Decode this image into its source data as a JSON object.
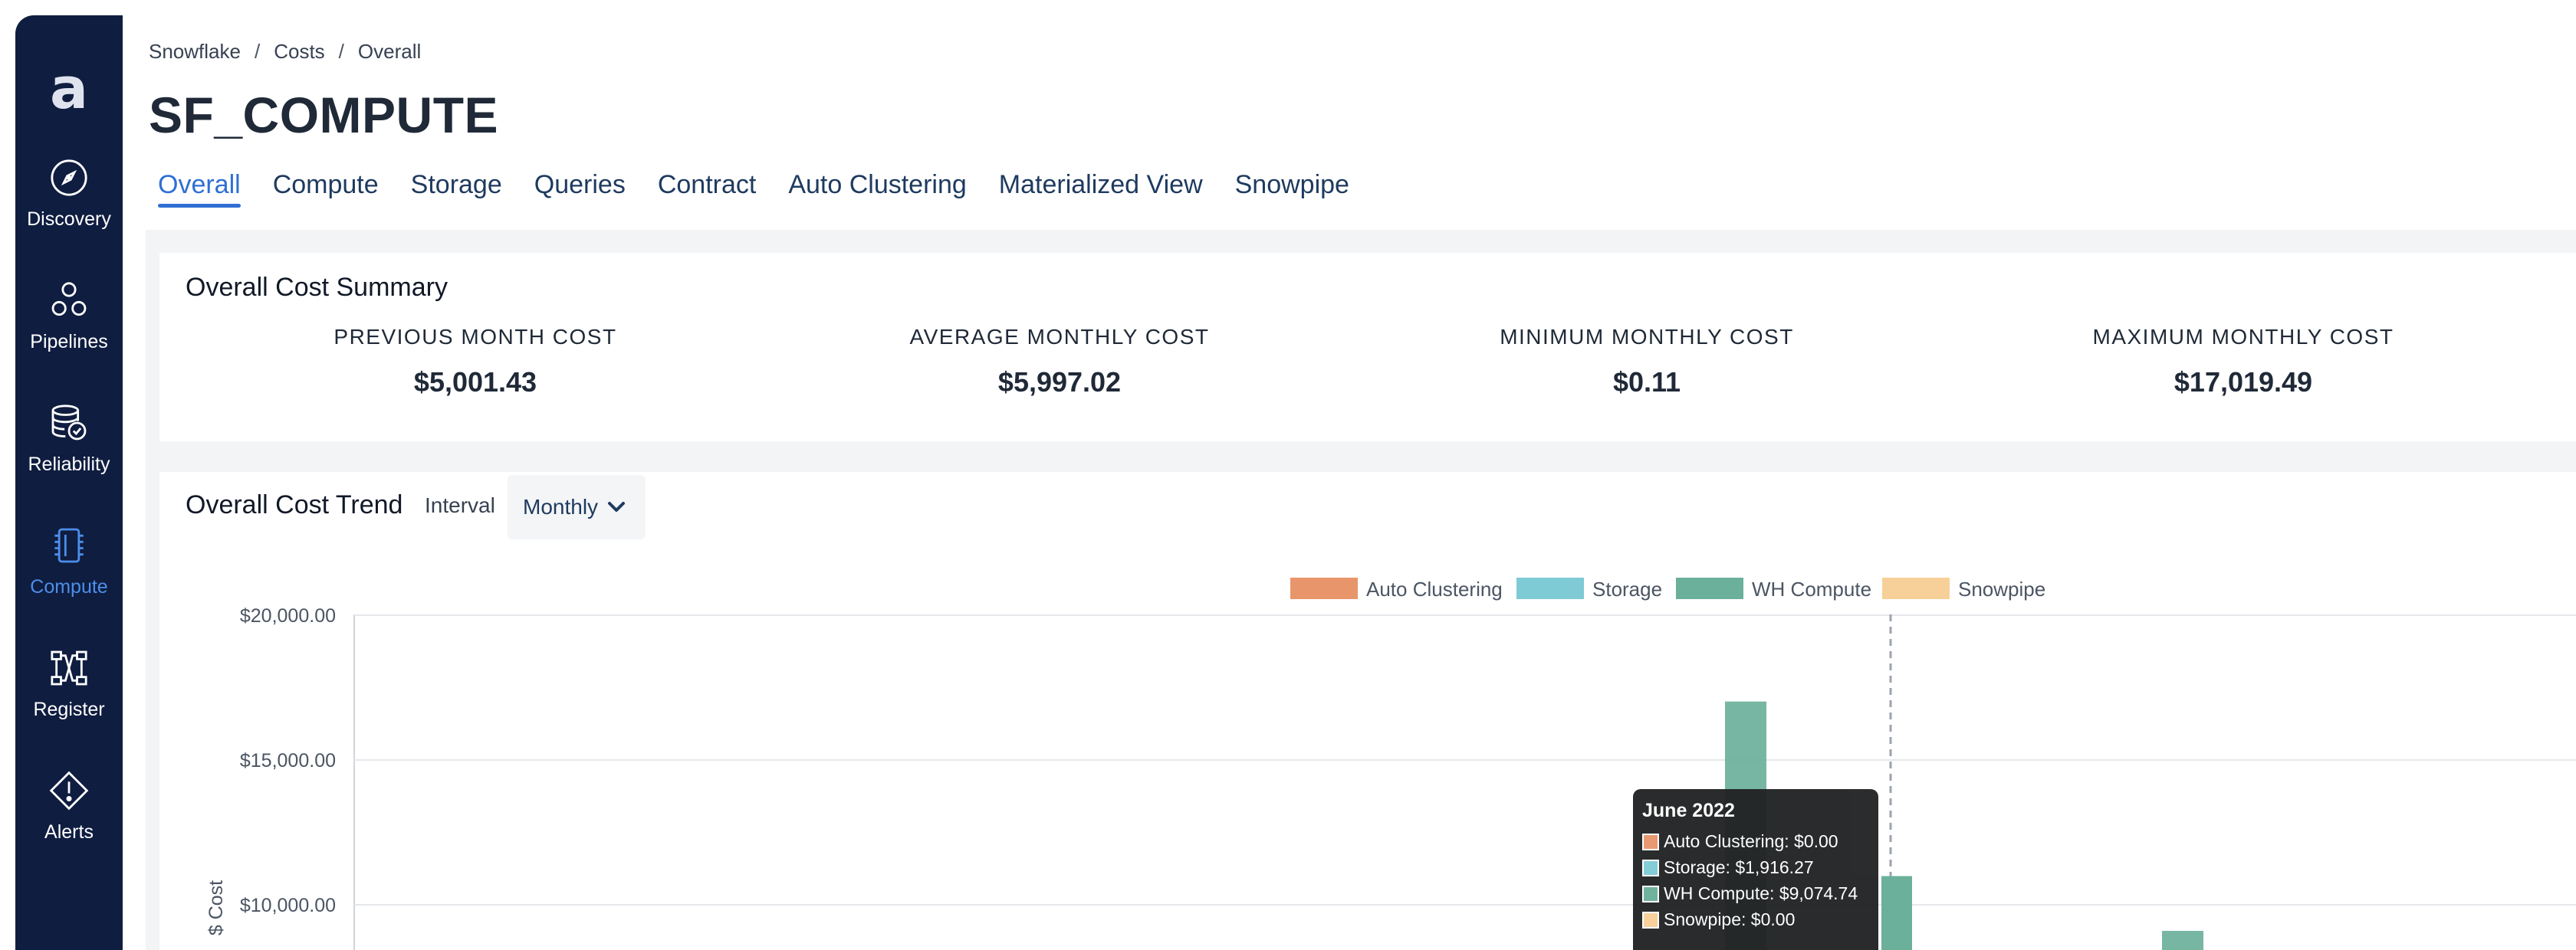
{
  "sidebar": {
    "logo": "a",
    "items": [
      {
        "label": "Discovery",
        "icon": "compass-icon",
        "active": false
      },
      {
        "label": "Pipelines",
        "icon": "pipelines-icon",
        "active": false
      },
      {
        "label": "Reliability",
        "icon": "database-check-icon",
        "active": false
      },
      {
        "label": "Compute",
        "icon": "chip-icon",
        "active": true
      },
      {
        "label": "Register",
        "icon": "register-icon",
        "active": false
      },
      {
        "label": "Alerts",
        "icon": "alert-diamond-icon",
        "active": false
      }
    ]
  },
  "breadcrumb": [
    "Snowflake",
    "Costs",
    "Overall"
  ],
  "breadcrumb_sep": "/",
  "title": "SF_COMPUTE",
  "tabs": [
    "Overall",
    "Compute",
    "Storage",
    "Queries",
    "Contract",
    "Auto Clustering",
    "Materialized View",
    "Snowpipe"
  ],
  "active_tab": "Overall",
  "summary": {
    "title": "Overall Cost Summary",
    "metrics": [
      {
        "label": "PREVIOUS MONTH COST",
        "value": "$5,001.43"
      },
      {
        "label": "AVERAGE MONTHLY COST",
        "value": "$5,997.02"
      },
      {
        "label": "MINIMUM MONTHLY COST",
        "value": "$0.11"
      },
      {
        "label": "MAXIMUM MONTHLY COST",
        "value": "$17,019.49"
      }
    ]
  },
  "trend": {
    "title": "Overall Cost Trend",
    "interval_label": "Interval",
    "interval_value": "Monthly"
  },
  "chart_data": {
    "type": "bar",
    "ylabel": "$ Cost",
    "y_ticks": [
      "$20,000.00",
      "$15,000.00",
      "$10,000.00"
    ],
    "y_visible_range": [
      8400,
      20000
    ],
    "legend_position": "top-center",
    "series": [
      {
        "name": "Auto Clustering",
        "color": "#e8956c"
      },
      {
        "name": "Storage",
        "color": "#7ecbd6"
      },
      {
        "name": "WH Compute",
        "color": "#6bb09a"
      },
      {
        "name": "Snowpipe",
        "color": "#f7cf98"
      }
    ],
    "visible_bars": [
      {
        "series": "WH Compute",
        "value": 17019.49
      },
      {
        "series": "WH Compute",
        "value": 9074.74,
        "stacked_on": 1916.27
      },
      {
        "series": "WH Compute",
        "value": 9100
      }
    ],
    "tooltip": {
      "title": "June 2022",
      "rows": [
        {
          "series": "Auto Clustering",
          "text": "Auto Clustering: $0.00",
          "color": "#e8956c"
        },
        {
          "series": "Storage",
          "text": "Storage: $1,916.27",
          "color": "#7ecbd6"
        },
        {
          "series": "WH Compute",
          "text": "WH Compute: $9,074.74",
          "color": "#6bb09a"
        },
        {
          "series": "Snowpipe",
          "text": "Snowpipe: $0.00",
          "color": "#f7cf98"
        }
      ]
    }
  }
}
